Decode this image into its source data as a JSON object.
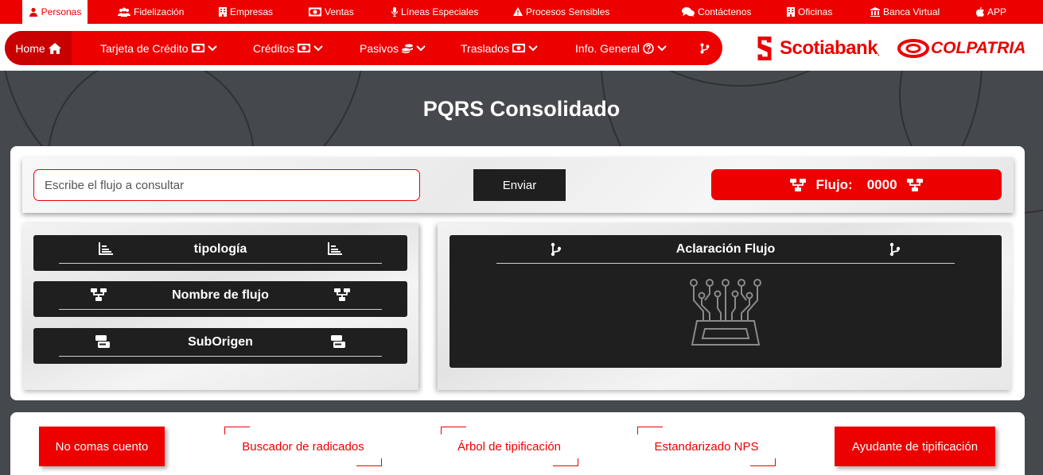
{
  "topbar": {
    "items": [
      {
        "label": "Personas",
        "icon": "user-icon"
      },
      {
        "label": "Fidelización",
        "icon": "users-icon"
      },
      {
        "label": "Empresas",
        "icon": "building-icon"
      },
      {
        "label": "Ventas",
        "icon": "money-icon"
      },
      {
        "label": "Líneas Especiales",
        "icon": "microphone-icon"
      },
      {
        "label": "Procesos Sensibles",
        "icon": "warning-icon"
      },
      {
        "label": "Contáctenos",
        "icon": "chat-icon"
      },
      {
        "label": "Oficinas",
        "icon": "building-icon"
      },
      {
        "label": "Banca Virtual",
        "icon": "bank-icon"
      },
      {
        "label": "APP",
        "icon": "apple-icon"
      }
    ]
  },
  "nav": {
    "home": "Home",
    "items": [
      {
        "label": "Tarjeta de Crédito",
        "icon": "money-icon"
      },
      {
        "label": "Créditos",
        "icon": "money-icon"
      },
      {
        "label": "Pasivos",
        "icon": "coins-icon"
      },
      {
        "label": "Traslados",
        "icon": "money-icon"
      },
      {
        "label": "Info. General",
        "icon": "question-circle-icon"
      }
    ]
  },
  "brand": {
    "scotiabank": "Scotiabank",
    "colpatria": "COLPATRIA"
  },
  "page": {
    "title": "PQRS Consolidado"
  },
  "search": {
    "placeholder": "Escribe el flujo a consultar",
    "button": "Enviar"
  },
  "flujo": {
    "label": "Flujo:",
    "value": "0000"
  },
  "info_boxes": [
    {
      "label": "tipología",
      "icon": "chart-icon"
    },
    {
      "label": "Nombre de flujo",
      "icon": "sitemap-icon"
    },
    {
      "label": "SubOrigen",
      "icon": "card-icon"
    }
  ],
  "aclaracion": {
    "label": "Aclaración Flujo",
    "icon": "branch-icon"
  },
  "bottom": {
    "no_comas_cuento": "No comas cuento",
    "buscador": "Buscador de radicados",
    "arbol": "Árbol de tipificación",
    "nps": "Estandarizado NPS",
    "ayudante": "Ayudante de tipificación"
  },
  "colors": {
    "brand_red": "#ec0000",
    "dark": "#1f1f1f",
    "background": "#45484c"
  }
}
